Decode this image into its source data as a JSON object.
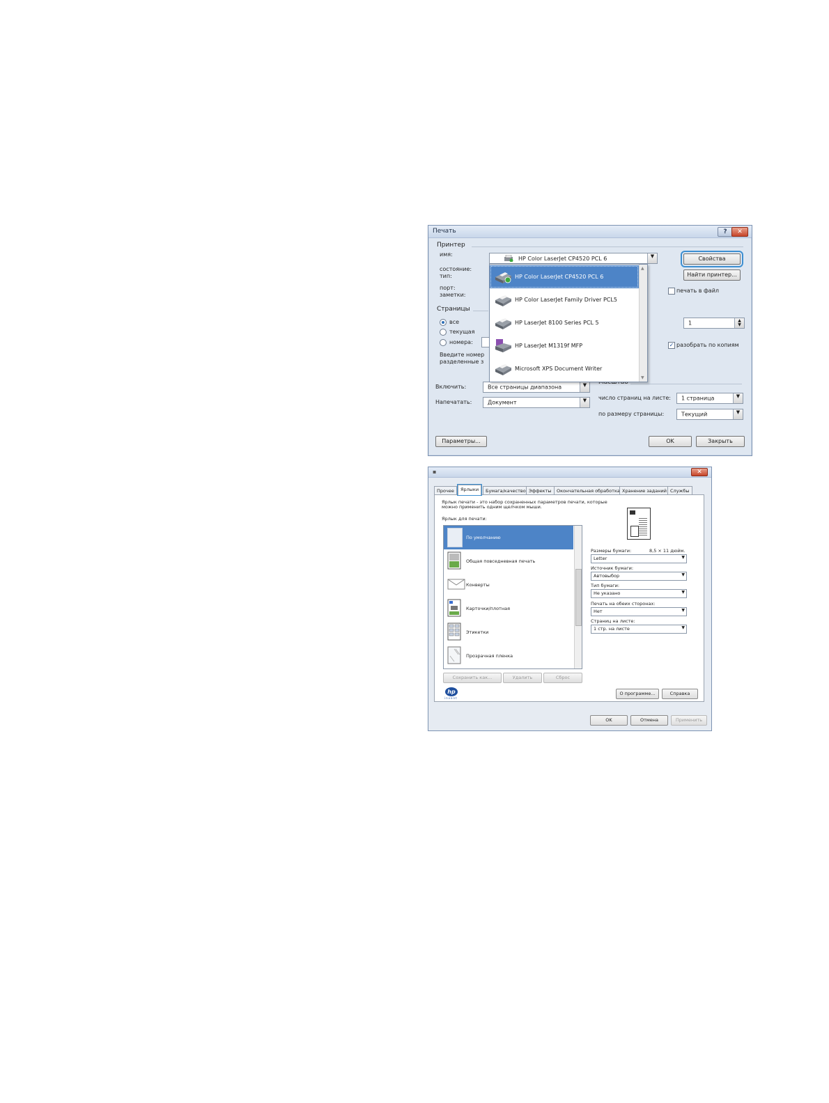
{
  "print_dialog": {
    "title": "Печать",
    "printer_group": "Принтер",
    "labels": {
      "name": "имя:",
      "status": "состояние:",
      "type": "тип:",
      "port": "порт:",
      "notes": "заметки:"
    },
    "selected_printer": "HP Color LaserJet CP4520 PCL 6",
    "printer_list": [
      "HP Color LaserJet CP4520 PCL 6",
      "HP Color LaserJet Family Driver PCL5",
      "HP LaserJet 8100 Series PCL 5",
      "HP LaserJet M1319f MFP",
      "Microsoft XPS Document Writer"
    ],
    "properties_button": "Свойства",
    "find_printer_button": "Найти принтер...",
    "print_to_file": "печать в файл",
    "pages_group": "Страницы",
    "radio_all": "все",
    "radio_current": "текущая",
    "radio_numbers": "номера:",
    "hint_line1": "Введите номер",
    "hint_line2": "разделенные з",
    "copies_value": "1",
    "collate": "разобрать по копиям",
    "include_label": "Включить:",
    "include_value": "Все страницы диапазона",
    "print_label": "Напечатать:",
    "print_value": "Документ",
    "scale_group": "Масштаб",
    "pages_per_sheet_label": "число страниц на листе:",
    "pages_per_sheet_value": "1 страница",
    "fit_label": "по размеру страницы:",
    "fit_value": "Текущий",
    "options_button": "Параметры...",
    "ok_button": "OK",
    "close_button": "Закрыть"
  },
  "props_dialog": {
    "tabs": [
      "Прочее",
      "Ярлыки",
      "Бумага/качество",
      "Эффекты",
      "Окончательная обработка",
      "Хранение заданий",
      "Службы"
    ],
    "description_line1": "Ярлык печати - это набор сохраненных параметров печати, которые",
    "description_line2": "можно применить одним щелчком мыши.",
    "shortcuts_label": "Ярлык для печати:",
    "shortcuts": [
      "По умолчанию",
      "Общая повседневная печать",
      "Конверты",
      "Карточки/плотная",
      "Этикетки",
      "Прозрачная пленка"
    ],
    "paper_size_label": "Размеры бумаги:",
    "paper_size_dims": "8,5 × 11 дюйм.",
    "paper_size_value": "Letter",
    "paper_source_label": "Источник бумаги:",
    "paper_source_value": "Автовыбор",
    "paper_type_label": "Тип бумаги:",
    "paper_type_value": "Не указано",
    "duplex_label": "Печать на обеих сторонах:",
    "duplex_value": "Нет",
    "pages_per_sheet_label": "Страниц на листе:",
    "pages_per_sheet_value": "1 стр. на листе",
    "save_as_button": "Сохранить как...",
    "delete_button": "Удалить",
    "reset_button": "Сброс",
    "about_button": "О программе...",
    "help_button": "Справка",
    "ok_button": "OK",
    "cancel_button": "Отмена",
    "apply_button": "Применить",
    "logo_subtext": "invent"
  }
}
